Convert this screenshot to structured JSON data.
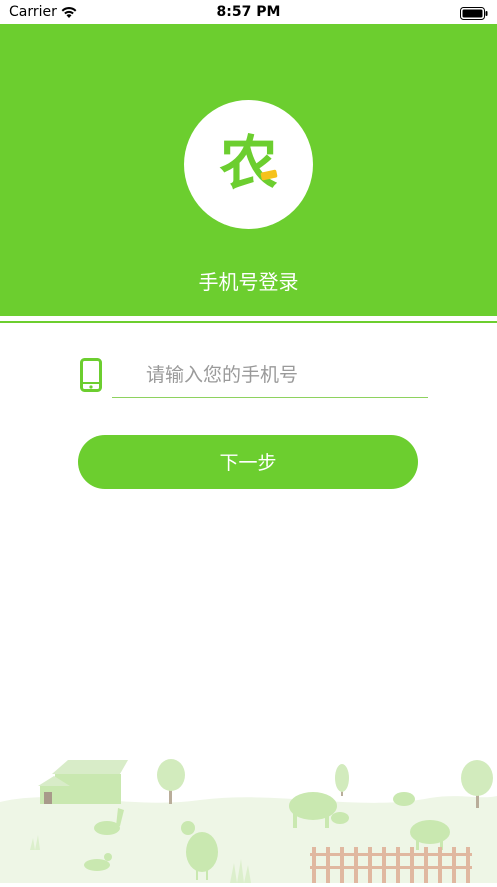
{
  "status_bar": {
    "carrier": "Carrier",
    "time": "8:57 PM",
    "icons": [
      "wifi-icon",
      "battery-icon"
    ]
  },
  "header": {
    "logo_text": "农",
    "title": "手机号登录"
  },
  "login": {
    "phone_placeholder": "请输入您的手机号",
    "phone_value": "",
    "next_label": "下一步"
  },
  "colors": {
    "brand_green": "#6cce2f",
    "logo_accent": "#f6c21c",
    "illustration": "#c9e8b0"
  },
  "illustration_icons": [
    "farm-house-icon",
    "tree-icon",
    "cow-icon",
    "pig-icon",
    "goose-icon",
    "chicken-icon",
    "duck-icon",
    "sheep-icon",
    "fence-icon",
    "grass-icon"
  ]
}
